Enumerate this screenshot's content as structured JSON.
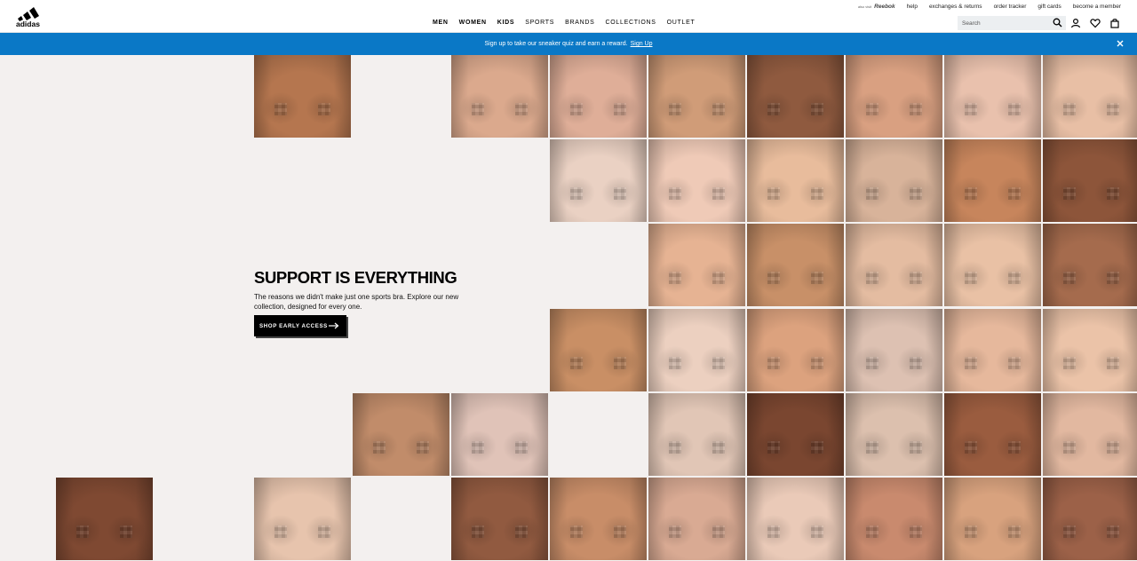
{
  "brand": {
    "logo_text": "adidas",
    "partner_label": "also visit",
    "partner_name": "Reebok"
  },
  "top_links": [
    "help",
    "exchanges & returns",
    "order tracker",
    "gift cards",
    "become a member"
  ],
  "nav": [
    {
      "label": "MEN",
      "bold": true
    },
    {
      "label": "WOMEN",
      "bold": true
    },
    {
      "label": "KIDS",
      "bold": true
    },
    {
      "label": "SPORTS",
      "bold": false
    },
    {
      "label": "BRANDS",
      "bold": false
    },
    {
      "label": "COLLECTIONS",
      "bold": false
    },
    {
      "label": "OUTLET",
      "bold": false
    }
  ],
  "search": {
    "placeholder": "Search"
  },
  "promo": {
    "text": "Sign up to take our sneaker quiz and earn a reward.",
    "link": "Sign Up"
  },
  "hero": {
    "title": "SUPPORT IS EVERYTHING",
    "body": "The reasons we didn't make just one sports bra. Explore our new collection, designed for every one.",
    "cta": "SHOP EARLY ACCESS"
  },
  "tiles": [
    {
      "col": 2,
      "row": 0,
      "tone": "#b5764f"
    },
    {
      "col": 4,
      "row": 0,
      "tone": "#dba98d"
    },
    {
      "col": 5,
      "row": 0,
      "tone": "#dfae98"
    },
    {
      "col": 6,
      "row": 0,
      "tone": "#d09c78"
    },
    {
      "col": 7,
      "row": 0,
      "tone": "#8f5a3f"
    },
    {
      "col": 8,
      "row": 0,
      "tone": "#d9a081"
    },
    {
      "col": 9,
      "row": 0,
      "tone": "#e9c1ad"
    },
    {
      "col": 10,
      "row": 0,
      "tone": "#e8bfa5"
    },
    {
      "col": 5,
      "row": 1,
      "tone": "#ead1c3"
    },
    {
      "col": 6,
      "row": 1,
      "tone": "#efcab7"
    },
    {
      "col": 7,
      "row": 1,
      "tone": "#e8bc9c"
    },
    {
      "col": 8,
      "row": 1,
      "tone": "#d8b39a"
    },
    {
      "col": 9,
      "row": 1,
      "tone": "#c7855c"
    },
    {
      "col": 10,
      "row": 1,
      "tone": "#8d553a"
    },
    {
      "col": 6,
      "row": 2,
      "tone": "#e6b393"
    },
    {
      "col": 7,
      "row": 2,
      "tone": "#c89068"
    },
    {
      "col": 8,
      "row": 2,
      "tone": "#e4bca1"
    },
    {
      "col": 9,
      "row": 2,
      "tone": "#e9c1a5"
    },
    {
      "col": 10,
      "row": 2,
      "tone": "#a56b4d"
    },
    {
      "col": 5,
      "row": 3,
      "tone": "#c98f65"
    },
    {
      "col": 6,
      "row": 3,
      "tone": "#ecd0c0"
    },
    {
      "col": 7,
      "row": 3,
      "tone": "#dca27e"
    },
    {
      "col": 8,
      "row": 3,
      "tone": "#ddc1b2"
    },
    {
      "col": 9,
      "row": 3,
      "tone": "#e6b89c"
    },
    {
      "col": 10,
      "row": 3,
      "tone": "#ebc3a8"
    },
    {
      "col": 3,
      "row": 4,
      "tone": "#c18c6a"
    },
    {
      "col": 4,
      "row": 4,
      "tone": "#e0c3b8"
    },
    {
      "col": 6,
      "row": 4,
      "tone": "#e1c6b6"
    },
    {
      "col": 7,
      "row": 4,
      "tone": "#7a4630"
    },
    {
      "col": 8,
      "row": 4,
      "tone": "#dcc0ae"
    },
    {
      "col": 9,
      "row": 4,
      "tone": "#9a5c3f"
    },
    {
      "col": 10,
      "row": 4,
      "tone": "#e2b8a0"
    },
    {
      "col": 0,
      "row": 5,
      "tone": "#7f4932"
    },
    {
      "col": 2,
      "row": 5,
      "tone": "#e7c4ad"
    },
    {
      "col": 4,
      "row": 5,
      "tone": "#915a40"
    },
    {
      "col": 5,
      "row": 5,
      "tone": "#c88d68"
    },
    {
      "col": 6,
      "row": 5,
      "tone": "#d9aa93"
    },
    {
      "col": 7,
      "row": 5,
      "tone": "#eacab8"
    },
    {
      "col": 8,
      "row": 5,
      "tone": "#c98a6e"
    },
    {
      "col": 9,
      "row": 5,
      "tone": "#d8a27e"
    },
    {
      "col": 10,
      "row": 5,
      "tone": "#9c6148"
    }
  ]
}
